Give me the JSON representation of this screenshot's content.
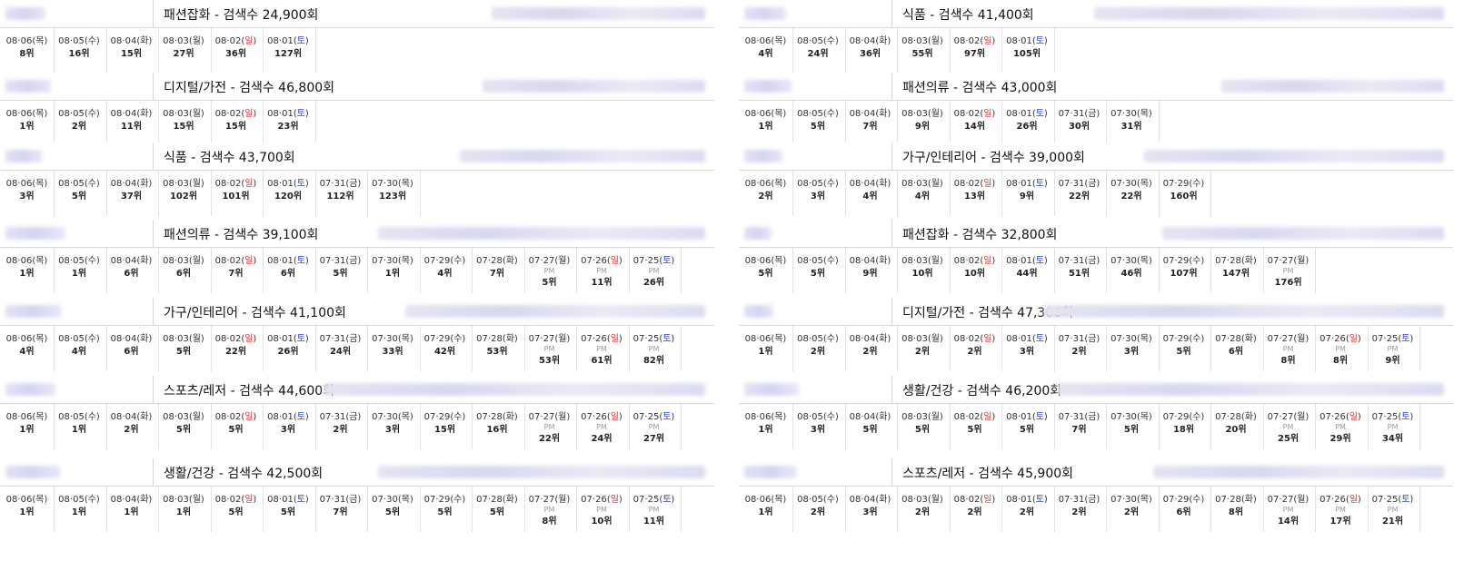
{
  "colors": {
    "sunday": "#e03030",
    "saturday": "#3040d0",
    "pm_text": "#999999",
    "border": "#d8d8d8"
  },
  "columns": [
    [
      {
        "category": "패션잡화",
        "searches": "검색수 24,900회",
        "days": [
          {
            "date": "08·06",
            "wd": "목",
            "rank": "8위"
          },
          {
            "date": "08·05",
            "wd": "수",
            "rank": "16위"
          },
          {
            "date": "08·04",
            "wd": "화",
            "rank": "15위"
          },
          {
            "date": "08·03",
            "wd": "월",
            "rank": "27위"
          },
          {
            "date": "08·02",
            "wd": "일",
            "rank": "36위"
          },
          {
            "date": "08·01",
            "wd": "토",
            "rank": "127위"
          }
        ]
      },
      {
        "category": "디지털/가전",
        "searches": "검색수 46,800회",
        "days": [
          {
            "date": "08·06",
            "wd": "목",
            "rank": "1위"
          },
          {
            "date": "08·05",
            "wd": "수",
            "rank": "2위"
          },
          {
            "date": "08·04",
            "wd": "화",
            "rank": "11위"
          },
          {
            "date": "08·03",
            "wd": "월",
            "rank": "15위"
          },
          {
            "date": "08·02",
            "wd": "일",
            "rank": "15위"
          },
          {
            "date": "08·01",
            "wd": "토",
            "rank": "23위"
          }
        ]
      },
      {
        "category": "식품",
        "searches": "검색수 43,700회",
        "days": [
          {
            "date": "08·06",
            "wd": "목",
            "rank": "3위"
          },
          {
            "date": "08·05",
            "wd": "수",
            "rank": "5위"
          },
          {
            "date": "08·04",
            "wd": "화",
            "rank": "37위"
          },
          {
            "date": "08·03",
            "wd": "월",
            "rank": "102위"
          },
          {
            "date": "08·02",
            "wd": "일",
            "rank": "101위"
          },
          {
            "date": "08·01",
            "wd": "토",
            "rank": "120위"
          },
          {
            "date": "07·31",
            "wd": "금",
            "rank": "112위"
          },
          {
            "date": "07·30",
            "wd": "목",
            "rank": "123위"
          }
        ]
      },
      {
        "category": "패션의류",
        "searches": "검색수 39,100회",
        "days": [
          {
            "date": "08·06",
            "wd": "목",
            "rank": "1위"
          },
          {
            "date": "08·05",
            "wd": "수",
            "rank": "1위"
          },
          {
            "date": "08·04",
            "wd": "화",
            "rank": "6위"
          },
          {
            "date": "08·03",
            "wd": "월",
            "rank": "6위"
          },
          {
            "date": "08·02",
            "wd": "일",
            "rank": "7위"
          },
          {
            "date": "08·01",
            "wd": "토",
            "rank": "6위"
          },
          {
            "date": "07·31",
            "wd": "금",
            "rank": "5위"
          },
          {
            "date": "07·30",
            "wd": "목",
            "rank": "1위"
          },
          {
            "date": "07·29",
            "wd": "수",
            "rank": "4위"
          },
          {
            "date": "07·28",
            "wd": "화",
            "rank": "7위"
          },
          {
            "date": "07·27",
            "wd": "월",
            "pm": "PM",
            "rank": "5위"
          },
          {
            "date": "07·26",
            "wd": "일",
            "pm": "PM",
            "rank": "11위"
          },
          {
            "date": "07·25",
            "wd": "토",
            "pm": "PM",
            "rank": "26위"
          }
        ]
      },
      {
        "category": "가구/인테리어",
        "searches": "검색수 41,100회",
        "days": [
          {
            "date": "08·06",
            "wd": "목",
            "rank": "4위"
          },
          {
            "date": "08·05",
            "wd": "수",
            "rank": "4위"
          },
          {
            "date": "08·04",
            "wd": "화",
            "rank": "6위"
          },
          {
            "date": "08·03",
            "wd": "월",
            "rank": "5위"
          },
          {
            "date": "08·02",
            "wd": "일",
            "rank": "22위"
          },
          {
            "date": "08·01",
            "wd": "토",
            "rank": "26위"
          },
          {
            "date": "07·31",
            "wd": "금",
            "rank": "24위"
          },
          {
            "date": "07·30",
            "wd": "목",
            "rank": "33위"
          },
          {
            "date": "07·29",
            "wd": "수",
            "rank": "42위"
          },
          {
            "date": "07·28",
            "wd": "화",
            "rank": "53위"
          },
          {
            "date": "07·27",
            "wd": "월",
            "pm": "PM",
            "rank": "53위"
          },
          {
            "date": "07·26",
            "wd": "일",
            "pm": "PM",
            "rank": "61위"
          },
          {
            "date": "07·25",
            "wd": "토",
            "pm": "PM",
            "rank": "82위"
          }
        ]
      },
      {
        "category": "스포츠/레저",
        "searches": "검색수 44,600회",
        "days": [
          {
            "date": "08·06",
            "wd": "목",
            "rank": "1위"
          },
          {
            "date": "08·05",
            "wd": "수",
            "rank": "1위"
          },
          {
            "date": "08·04",
            "wd": "화",
            "rank": "2위"
          },
          {
            "date": "08·03",
            "wd": "월",
            "rank": "5위"
          },
          {
            "date": "08·02",
            "wd": "일",
            "rank": "5위"
          },
          {
            "date": "08·01",
            "wd": "토",
            "rank": "3위"
          },
          {
            "date": "07·31",
            "wd": "금",
            "rank": "2위"
          },
          {
            "date": "07·30",
            "wd": "목",
            "rank": "3위"
          },
          {
            "date": "07·29",
            "wd": "수",
            "rank": "15위"
          },
          {
            "date": "07·28",
            "wd": "화",
            "rank": "16위"
          },
          {
            "date": "07·27",
            "wd": "월",
            "pm": "PM",
            "rank": "22위"
          },
          {
            "date": "07·26",
            "wd": "일",
            "pm": "PM",
            "rank": "24위"
          },
          {
            "date": "07·25",
            "wd": "토",
            "pm": "PM",
            "rank": "27위"
          }
        ]
      },
      {
        "category": "생활/건강",
        "searches": "검색수 42,500회",
        "days": [
          {
            "date": "08·06",
            "wd": "목",
            "rank": "1위"
          },
          {
            "date": "08·05",
            "wd": "수",
            "rank": "1위"
          },
          {
            "date": "08·04",
            "wd": "화",
            "rank": "1위"
          },
          {
            "date": "08·03",
            "wd": "월",
            "rank": "1위"
          },
          {
            "date": "08·02",
            "wd": "일",
            "rank": "5위"
          },
          {
            "date": "08·01",
            "wd": "토",
            "rank": "5위"
          },
          {
            "date": "07·31",
            "wd": "금",
            "rank": "7위"
          },
          {
            "date": "07·30",
            "wd": "목",
            "rank": "5위"
          },
          {
            "date": "07·29",
            "wd": "수",
            "rank": "5위"
          },
          {
            "date": "07·28",
            "wd": "화",
            "rank": "5위"
          },
          {
            "date": "07·27",
            "wd": "월",
            "pm": "PM",
            "rank": "8위"
          },
          {
            "date": "07·26",
            "wd": "일",
            "pm": "PM",
            "rank": "10위"
          },
          {
            "date": "07·25",
            "wd": "토",
            "pm": "PM",
            "rank": "11위"
          }
        ]
      }
    ],
    [
      {
        "category": "식품",
        "searches": "검색수 41,400회",
        "days": [
          {
            "date": "08·06",
            "wd": "목",
            "rank": "4위"
          },
          {
            "date": "08·05",
            "wd": "수",
            "rank": "24위"
          },
          {
            "date": "08·04",
            "wd": "화",
            "rank": "36위"
          },
          {
            "date": "08·03",
            "wd": "월",
            "rank": "55위"
          },
          {
            "date": "08·02",
            "wd": "일",
            "rank": "97위"
          },
          {
            "date": "08·01",
            "wd": "토",
            "rank": "105위"
          }
        ]
      },
      {
        "category": "패션의류",
        "searches": "검색수 43,000회",
        "days": [
          {
            "date": "08·06",
            "wd": "목",
            "rank": "1위"
          },
          {
            "date": "08·05",
            "wd": "수",
            "rank": "5위"
          },
          {
            "date": "08·04",
            "wd": "화",
            "rank": "7위"
          },
          {
            "date": "08·03",
            "wd": "월",
            "rank": "9위"
          },
          {
            "date": "08·02",
            "wd": "일",
            "rank": "14위"
          },
          {
            "date": "08·01",
            "wd": "토",
            "rank": "26위"
          },
          {
            "date": "07·31",
            "wd": "금",
            "rank": "30위"
          },
          {
            "date": "07·30",
            "wd": "목",
            "rank": "31위"
          }
        ]
      },
      {
        "category": "가구/인테리어",
        "searches": "검색수 39,000회",
        "days": [
          {
            "date": "08·06",
            "wd": "목",
            "rank": "2위"
          },
          {
            "date": "08·05",
            "wd": "수",
            "rank": "3위"
          },
          {
            "date": "08·04",
            "wd": "화",
            "rank": "4위"
          },
          {
            "date": "08·03",
            "wd": "월",
            "rank": "4위"
          },
          {
            "date": "08·02",
            "wd": "일",
            "rank": "13위"
          },
          {
            "date": "08·01",
            "wd": "토",
            "rank": "9위"
          },
          {
            "date": "07·31",
            "wd": "금",
            "rank": "22위"
          },
          {
            "date": "07·30",
            "wd": "목",
            "rank": "22위"
          },
          {
            "date": "07·29",
            "wd": "수",
            "rank": "160위"
          }
        ]
      },
      {
        "category": "패션잡화",
        "searches": "검색수 32,800회",
        "days": [
          {
            "date": "08·06",
            "wd": "목",
            "rank": "5위"
          },
          {
            "date": "08·05",
            "wd": "수",
            "rank": "5위"
          },
          {
            "date": "08·04",
            "wd": "화",
            "rank": "9위"
          },
          {
            "date": "08·03",
            "wd": "월",
            "rank": "10위"
          },
          {
            "date": "08·02",
            "wd": "일",
            "rank": "10위"
          },
          {
            "date": "08·01",
            "wd": "토",
            "rank": "44위"
          },
          {
            "date": "07·31",
            "wd": "금",
            "rank": "51위"
          },
          {
            "date": "07·30",
            "wd": "목",
            "rank": "46위"
          },
          {
            "date": "07·29",
            "wd": "수",
            "rank": "107위"
          },
          {
            "date": "07·28",
            "wd": "화",
            "rank": "147위"
          },
          {
            "date": "07·27",
            "wd": "월",
            "pm": "PM",
            "rank": "176위"
          }
        ]
      },
      {
        "category": "디지털/가전",
        "searches": "검색수 47,300회",
        "days": [
          {
            "date": "08·06",
            "wd": "목",
            "rank": "1위"
          },
          {
            "date": "08·05",
            "wd": "수",
            "rank": "2위"
          },
          {
            "date": "08·04",
            "wd": "화",
            "rank": "2위"
          },
          {
            "date": "08·03",
            "wd": "월",
            "rank": "2위"
          },
          {
            "date": "08·02",
            "wd": "일",
            "rank": "2위"
          },
          {
            "date": "08·01",
            "wd": "토",
            "rank": "3위"
          },
          {
            "date": "07·31",
            "wd": "금",
            "rank": "2위"
          },
          {
            "date": "07·30",
            "wd": "목",
            "rank": "3위"
          },
          {
            "date": "07·29",
            "wd": "수",
            "rank": "5위"
          },
          {
            "date": "07·28",
            "wd": "화",
            "rank": "6위"
          },
          {
            "date": "07·27",
            "wd": "월",
            "pm": "PM",
            "rank": "8위"
          },
          {
            "date": "07·26",
            "wd": "일",
            "pm": "PM",
            "rank": "8위"
          },
          {
            "date": "07·25",
            "wd": "토",
            "pm": "PM",
            "rank": "9위"
          }
        ]
      },
      {
        "category": "생활/건강",
        "searches": "검색수 46,200회",
        "days": [
          {
            "date": "08·06",
            "wd": "목",
            "rank": "1위"
          },
          {
            "date": "08·05",
            "wd": "수",
            "rank": "3위"
          },
          {
            "date": "08·04",
            "wd": "화",
            "rank": "5위"
          },
          {
            "date": "08·03",
            "wd": "월",
            "rank": "5위"
          },
          {
            "date": "08·02",
            "wd": "일",
            "rank": "5위"
          },
          {
            "date": "08·01",
            "wd": "토",
            "rank": "5위"
          },
          {
            "date": "07·31",
            "wd": "금",
            "rank": "7위"
          },
          {
            "date": "07·30",
            "wd": "목",
            "rank": "5위"
          },
          {
            "date": "07·29",
            "wd": "수",
            "rank": "18위"
          },
          {
            "date": "07·28",
            "wd": "화",
            "rank": "20위"
          },
          {
            "date": "07·27",
            "wd": "월",
            "pm": "PM",
            "rank": "25위"
          },
          {
            "date": "07·26",
            "wd": "일",
            "pm": "PM",
            "rank": "29위"
          },
          {
            "date": "07·25",
            "wd": "토",
            "pm": "PM",
            "rank": "34위"
          }
        ]
      },
      {
        "category": "스포츠/레저",
        "searches": "검색수 45,900회",
        "days": [
          {
            "date": "08·06",
            "wd": "목",
            "rank": "1위"
          },
          {
            "date": "08·05",
            "wd": "수",
            "rank": "2위"
          },
          {
            "date": "08·04",
            "wd": "화",
            "rank": "3위"
          },
          {
            "date": "08·03",
            "wd": "월",
            "rank": "2위"
          },
          {
            "date": "08·02",
            "wd": "일",
            "rank": "2위"
          },
          {
            "date": "08·01",
            "wd": "토",
            "rank": "2위"
          },
          {
            "date": "07·31",
            "wd": "금",
            "rank": "2위"
          },
          {
            "date": "07·30",
            "wd": "목",
            "rank": "2위"
          },
          {
            "date": "07·29",
            "wd": "수",
            "rank": "6위"
          },
          {
            "date": "07·28",
            "wd": "화",
            "rank": "8위"
          },
          {
            "date": "07·27",
            "wd": "월",
            "pm": "PM",
            "rank": "14위"
          },
          {
            "date": "07·26",
            "wd": "일",
            "pm": "PM",
            "rank": "17위"
          },
          {
            "date": "07·25",
            "wd": "토",
            "pm": "PM",
            "rank": "21위"
          }
        ]
      }
    ]
  ]
}
